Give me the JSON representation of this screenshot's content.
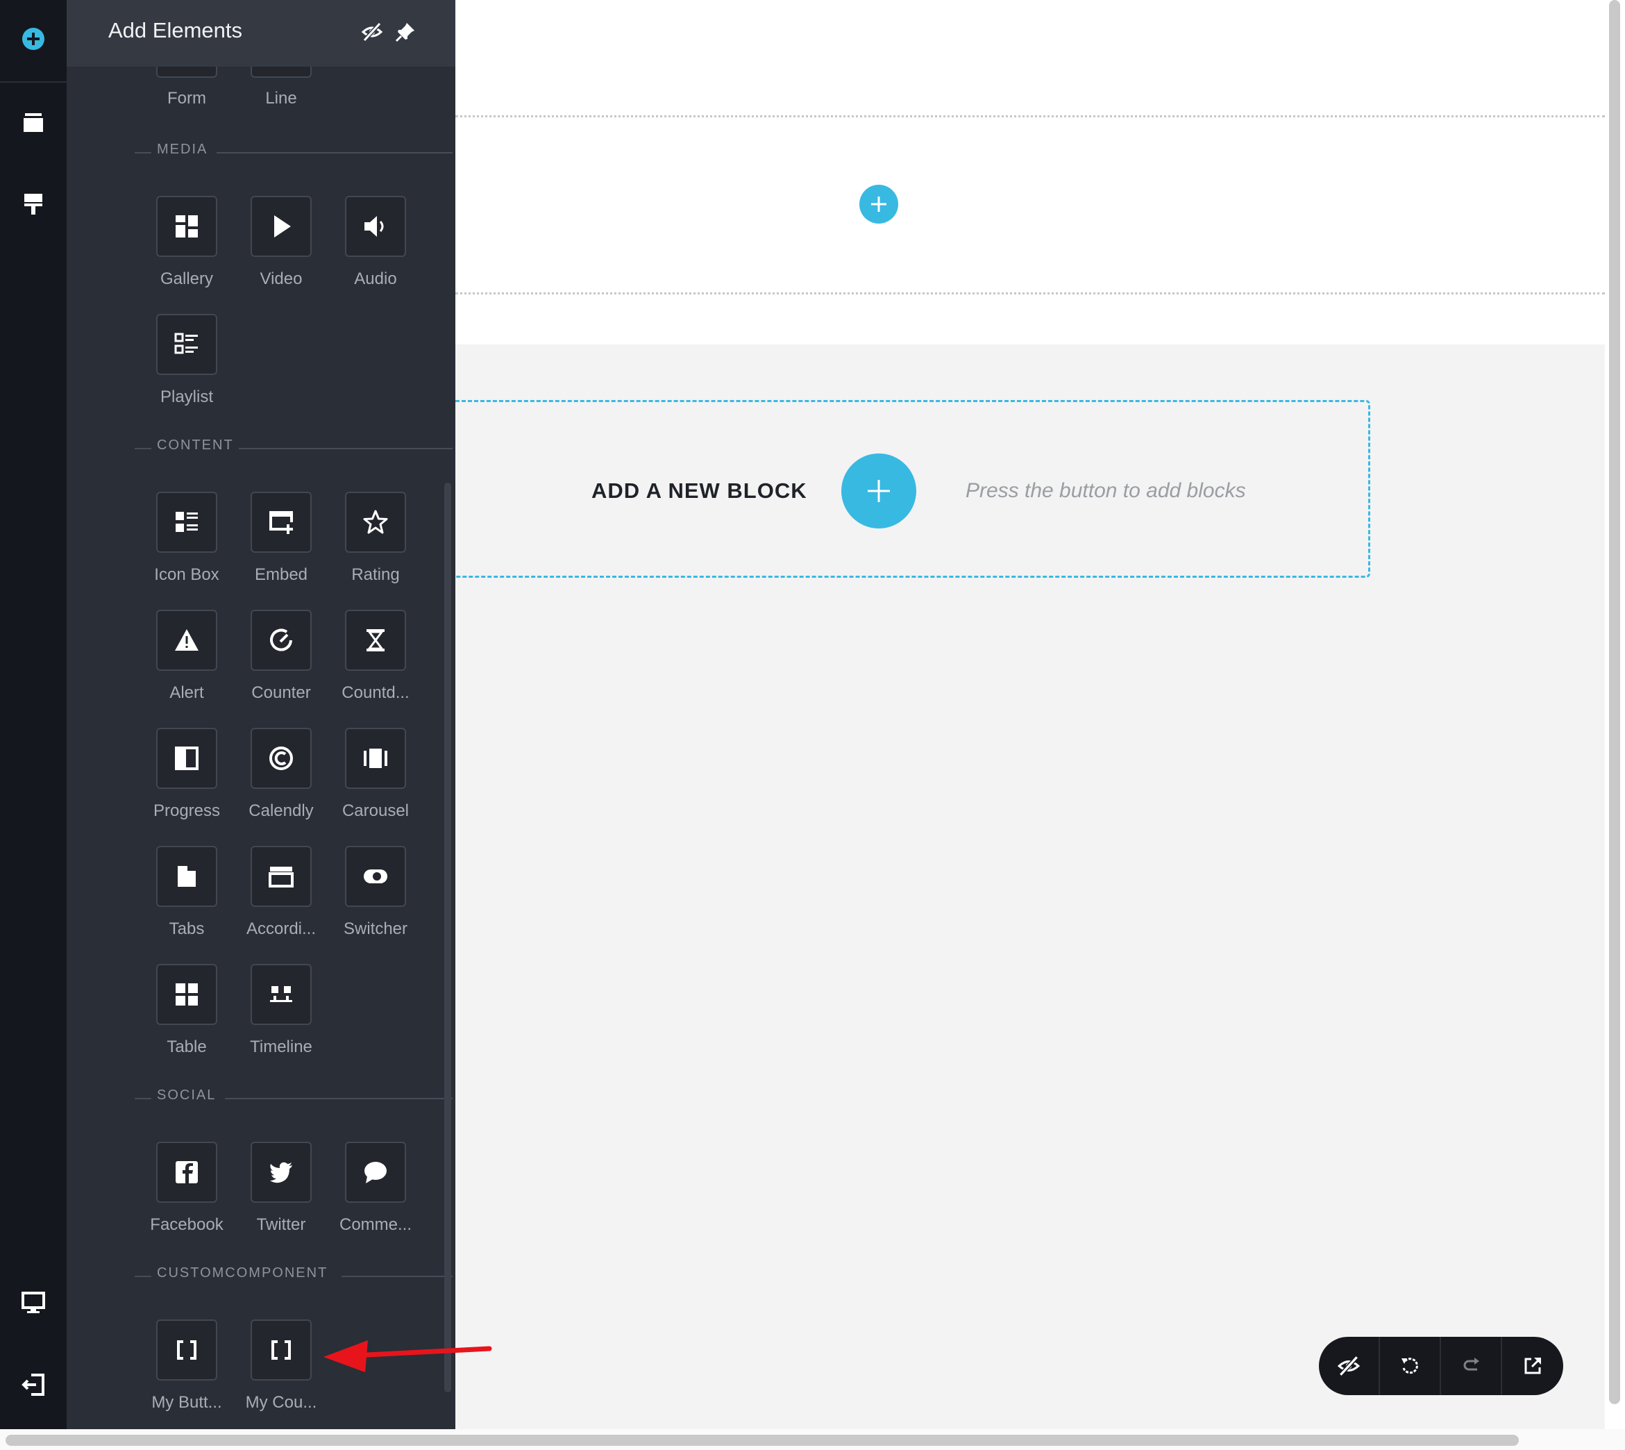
{
  "panel": {
    "title": "Add Elements",
    "sections": {
      "media": "MEDIA",
      "content": "CONTENT",
      "social": "SOCIAL",
      "custom": "CUSTOMCOMPONENT"
    },
    "elements": {
      "form": "Form",
      "line": "Line",
      "gallery": "Gallery",
      "video": "Video",
      "audio": "Audio",
      "playlist": "Playlist",
      "icon_box": "Icon Box",
      "embed": "Embed",
      "rating": "Rating",
      "alert": "Alert",
      "counter": "Counter",
      "countdown": "Countd...",
      "progress": "Progress",
      "calendly": "Calendly",
      "carousel": "Carousel",
      "tabs": "Tabs",
      "accordion": "Accordi...",
      "switcher": "Switcher",
      "table": "Table",
      "timeline": "Timeline",
      "facebook": "Facebook",
      "twitter": "Twitter",
      "comments": "Comme...",
      "my_button": "My Butt...",
      "my_counter": "My Cou..."
    }
  },
  "canvas": {
    "block_title": "ADD A NEW BLOCK",
    "block_hint": "Press the button to add blocks"
  },
  "colors": {
    "accent": "#38b9e2",
    "rail": "#14171d",
    "panel": "#2a2e36",
    "arrow": "#e8141c"
  }
}
